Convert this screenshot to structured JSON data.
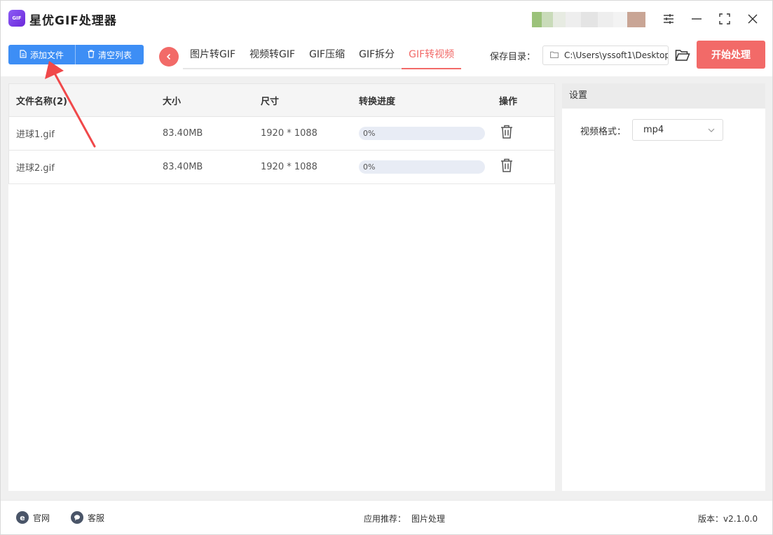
{
  "app": {
    "title": "星优GIF处理器",
    "logo_text": "GIF"
  },
  "toolbar": {
    "add_files": "添加文件",
    "clear_list": "清空列表",
    "tabs": [
      {
        "label": "图片转GIF",
        "active": false
      },
      {
        "label": "视频转GIF",
        "active": false
      },
      {
        "label": "GIF压缩",
        "active": false
      },
      {
        "label": "GIF拆分",
        "active": false
      },
      {
        "label": "GIF转视频",
        "active": true
      }
    ],
    "save_dir_label": "保存目录：",
    "save_dir_path": "C:\\Users\\yssoft1\\Desktop",
    "start_button": "开始处理"
  },
  "table": {
    "columns": [
      "文件名称(2)",
      "大小",
      "尺寸",
      "转换进度",
      "操作"
    ],
    "rows": [
      {
        "name": "进球1.gif",
        "size": "83.40MB",
        "dimensions": "1920 * 1088",
        "progress": 0,
        "progress_text": "0%"
      },
      {
        "name": "进球2.gif",
        "size": "83.40MB",
        "dimensions": "1920 * 1088",
        "progress": 0,
        "progress_text": "0%"
      }
    ]
  },
  "settings": {
    "title": "设置",
    "format_label": "视频格式：",
    "format_value": "mp4"
  },
  "footer": {
    "website": "官网",
    "support": "客服",
    "recommend_label": "应用推荐：",
    "recommend_link": "图片处理",
    "version": "版本：v2.1.0.0"
  },
  "colors": {
    "primary_blue": "#3d8ef5",
    "accent_red": "#f26a68",
    "annotation_red": "#f0484a"
  },
  "icons": {
    "add_files": "document-icon",
    "clear_list": "trash-icon",
    "back": "chevron-left-icon",
    "path": "folder-icon",
    "browse": "folder-open-icon",
    "row_delete": "trash-icon",
    "select": "chevron-down-icon",
    "website": "ie-browser-icon",
    "support": "chat-bubble-icon",
    "annotation": "arrow-pointer-icon"
  }
}
